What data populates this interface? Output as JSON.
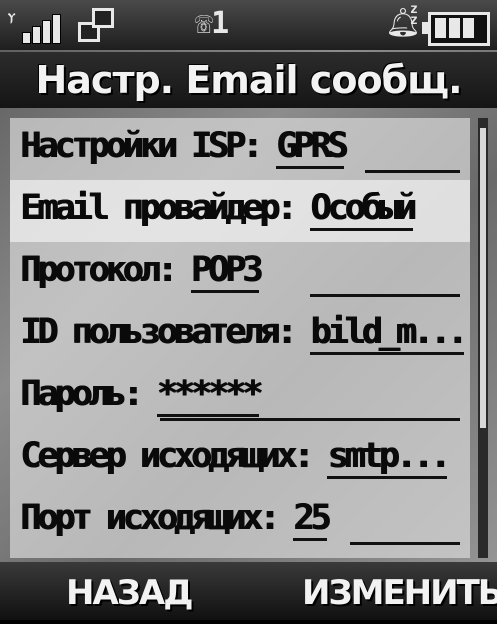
{
  "status": {
    "line_indicator": "1",
    "icons": [
      "signal-strength-icon",
      "network-icon",
      "line-icon",
      "silent-bell-icon",
      "battery-icon"
    ]
  },
  "title": "Настр. Email сообщ.",
  "items": [
    {
      "label": "Настройки ISP:",
      "value": "GPRS"
    },
    {
      "label": "Email провайдер:",
      "value": "Особый"
    },
    {
      "label": "Протокол:",
      "value": "POP3"
    },
    {
      "label": "ID пользователя:",
      "value": "bild_m..."
    },
    {
      "label": "Пароль:",
      "value": "******"
    },
    {
      "label": "Сервер исходящих:",
      "value": "smtp..."
    },
    {
      "label": "Порт исходящих:",
      "value": "25"
    }
  ],
  "softkeys": {
    "left": "НАЗАД",
    "right": "ИЗМЕНИТЬ"
  }
}
